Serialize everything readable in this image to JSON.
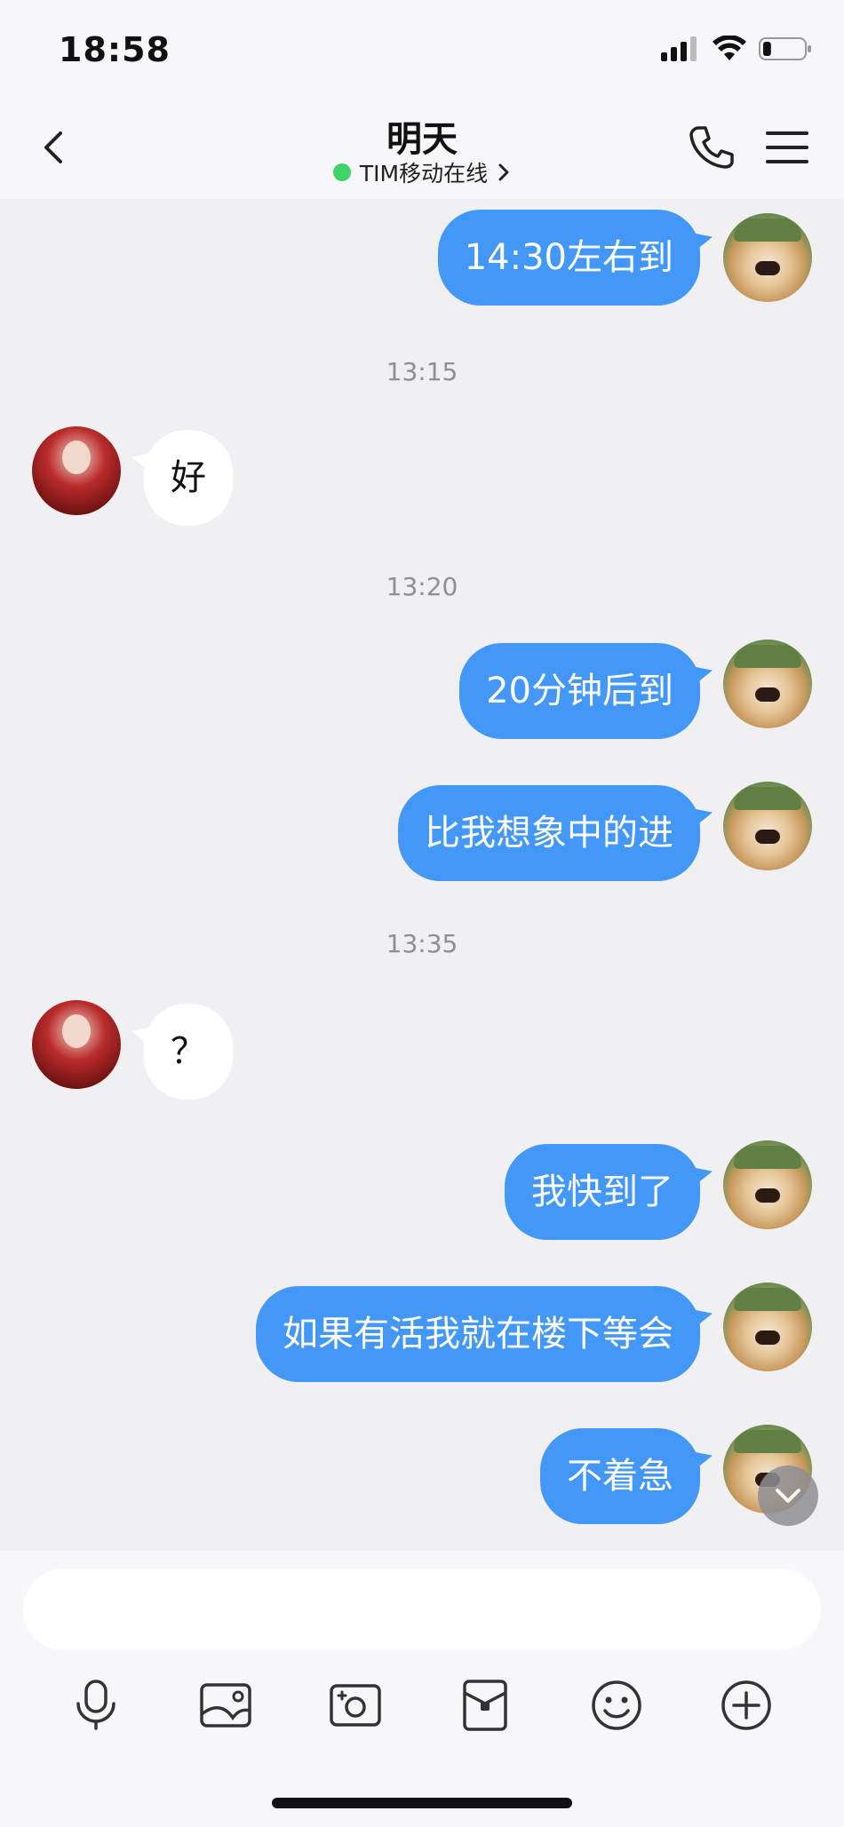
{
  "status_bar": {
    "time": "18:58",
    "battery_level": 0.2
  },
  "header": {
    "title": "明天",
    "subtitle": "TIM移动在线",
    "online_color": "#3fd36a"
  },
  "colors": {
    "my_bubble": "#4397f7",
    "peer_bubble": "#ffffff",
    "background": "#f0f0f2"
  },
  "messages": [
    {
      "type": "message",
      "from": "me",
      "text": "14:30左右到"
    },
    {
      "type": "timestamp",
      "text": "13:15"
    },
    {
      "type": "message",
      "from": "peer",
      "text": "好"
    },
    {
      "type": "timestamp",
      "text": "13:20"
    },
    {
      "type": "message",
      "from": "me",
      "text": "20分钟后到"
    },
    {
      "type": "message",
      "from": "me",
      "text": "比我想象中的进"
    },
    {
      "type": "timestamp",
      "text": "13:35"
    },
    {
      "type": "message",
      "from": "peer",
      "text": "？"
    },
    {
      "type": "message",
      "from": "me",
      "text": "我快到了"
    },
    {
      "type": "message",
      "from": "me",
      "text": "如果有活我就在楼下等会"
    },
    {
      "type": "message",
      "from": "me",
      "text": "不着急"
    }
  ],
  "input": {
    "value": "",
    "placeholder": ""
  },
  "toolbar": [
    {
      "icon": "microphone-icon"
    },
    {
      "icon": "image-icon"
    },
    {
      "icon": "camera-icon"
    },
    {
      "icon": "red-packet-icon"
    },
    {
      "icon": "emoji-icon"
    },
    {
      "icon": "plus-icon"
    }
  ]
}
